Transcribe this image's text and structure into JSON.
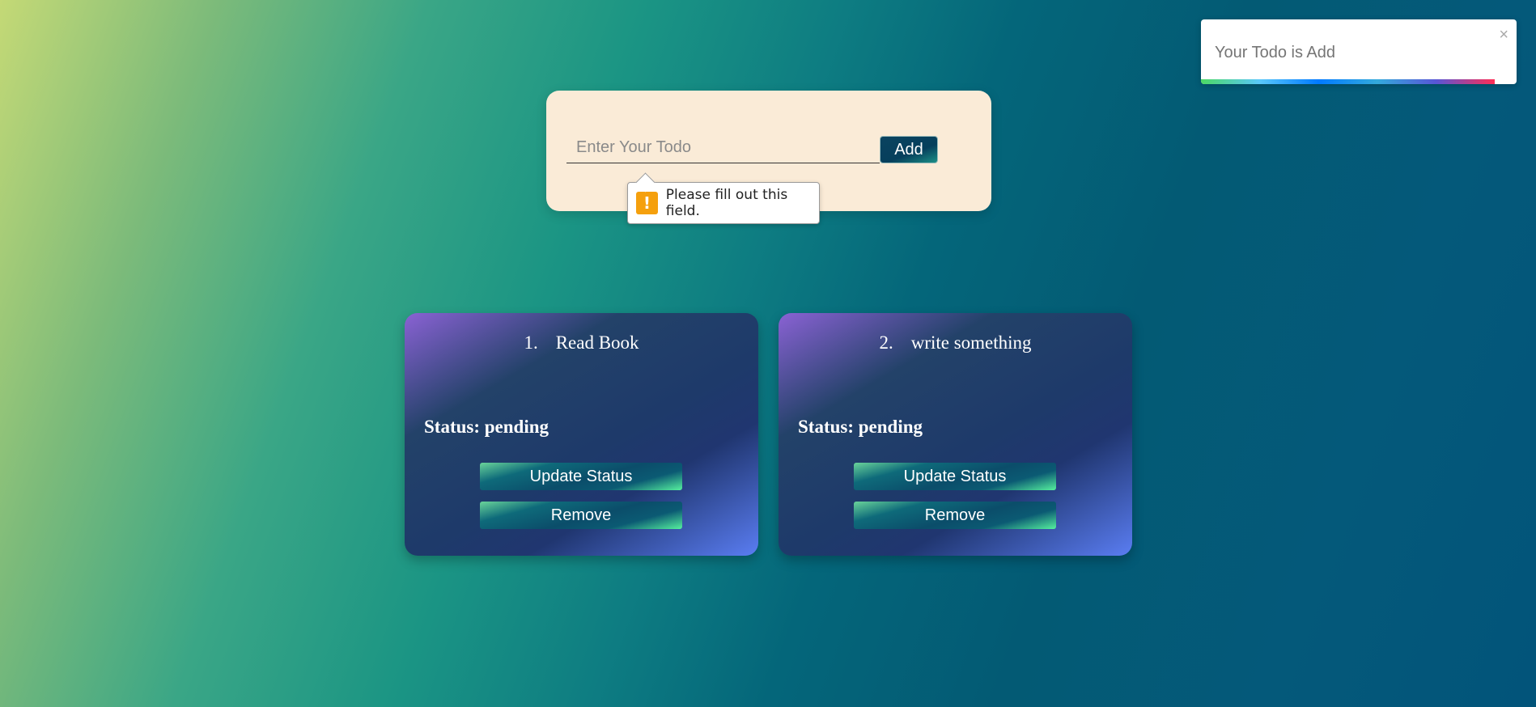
{
  "form": {
    "input_value": "",
    "input_placeholder": "Enter Your Todo",
    "add_label": "Add"
  },
  "validation": {
    "icon": "!",
    "message": "Please fill out this field."
  },
  "toast": {
    "message": "Your Todo is Add",
    "close_glyph": "×",
    "progress": 0.93
  },
  "todos": [
    {
      "number": "1.",
      "title": "Read Book",
      "status": "Status: pending",
      "update_label": "Update Status",
      "remove_label": "Remove"
    },
    {
      "number": "2.",
      "title": "write something",
      "status": "Status: pending",
      "update_label": "Update Status",
      "remove_label": "Remove"
    }
  ]
}
